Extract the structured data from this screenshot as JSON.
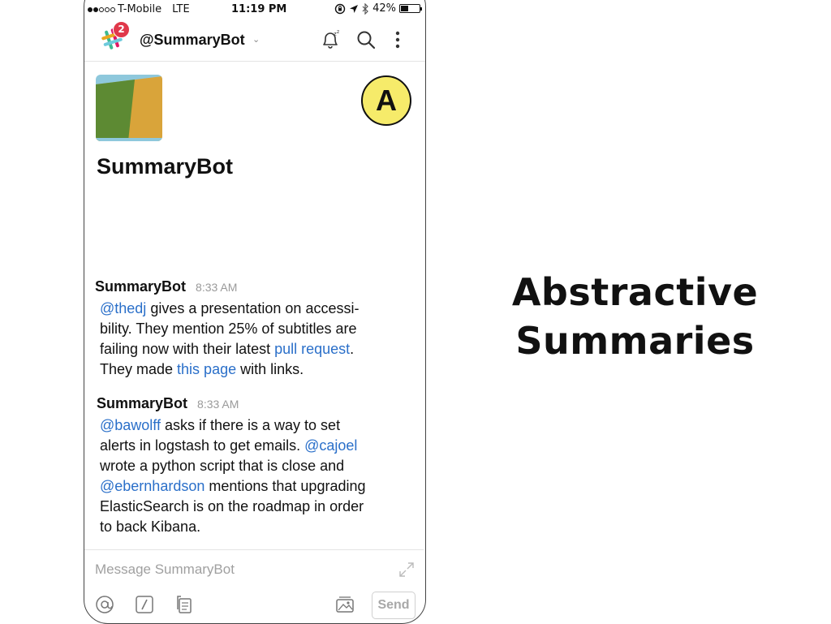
{
  "status_bar": {
    "carrier": "T-Mobile",
    "network": "LTE",
    "time": "11:19 PM",
    "battery": "42%",
    "battery_level": 0.42,
    "icons": [
      "signal-dots-icon",
      "rotation-lock-icon",
      "location-arrow-icon",
      "bluetooth-icon",
      "battery-icon"
    ]
  },
  "header": {
    "notification_count": "2",
    "channel_name": "@SummaryBot",
    "icons": [
      "slack-logo-icon",
      "chevron-down-icon",
      "snooze-bell-icon",
      "search-icon",
      "more-vertical-icon"
    ]
  },
  "bot_profile": {
    "name": "SummaryBot"
  },
  "messages": [
    {
      "author": "SummaryBot",
      "time": "8:33 AM",
      "line1": {
        "link1": "@thedj",
        "text1": " gives a presentation on accessi-"
      },
      "line2": "bility. They mention 25% of subtitles are",
      "line3": {
        "text1": "failing now with their latest ",
        "link1": "pull request",
        "text2": "."
      },
      "line4": {
        "text1": "They made ",
        "link1": "this page",
        "text2": " with links."
      }
    },
    {
      "author": "SummaryBot",
      "time": "8:33 AM",
      "line1": {
        "link1": "@bawolff",
        "text1": " asks if there is a way to set"
      },
      "line2": {
        "text1": "alerts in logstash to get emails. ",
        "link1": "@cajoel"
      },
      "line3": "wrote a python script that is close and",
      "line4": {
        "link1": "@ebernhardson",
        "text1": " mentions that upgrading"
      },
      "line5": "ElasticSearch is on the roadmap in order",
      "line6": "to back Kibana."
    }
  ],
  "composer": {
    "placeholder_prefix": "Message ",
    "placeholder_target": "SummaryBot",
    "send_label": "Send",
    "icons": [
      "expand-icon",
      "at-mention-icon",
      "slash-command-icon",
      "files-icon",
      "image-icon"
    ]
  },
  "annotation": {
    "marker": "A",
    "title_line1": "Abstractive",
    "title_line2": "Summaries"
  },
  "colors": {
    "link": "#2a6fc9",
    "badge": "#e0384a",
    "marker_fill": "#f6eb6a",
    "avatar_blue": "#8ec8dc",
    "avatar_green": "#5d8a33",
    "avatar_gold": "#d9a43a"
  }
}
